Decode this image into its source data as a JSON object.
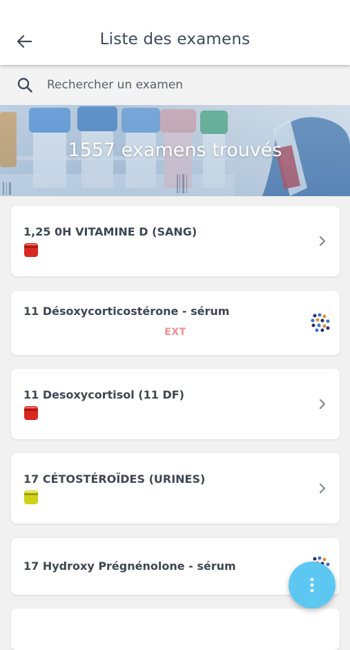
{
  "header": {
    "title": "Liste des examens",
    "back_icon": "arrow-left-icon"
  },
  "search": {
    "placeholder": "Rechercher un examen",
    "icon": "search-icon"
  },
  "banner": {
    "count_text": "1557 examens trouvés"
  },
  "exams": [
    {
      "name": "1,25 0H VITAMINE D (SANG)",
      "tube_color": "#d9281f",
      "action": "chevron"
    },
    {
      "name": "11 Désoxycorticostérone - sérum",
      "badge": "EXT",
      "action": "partner"
    },
    {
      "name": "11 Desoxycortisol (11 DF)",
      "tube_color": "#d9281f",
      "action": "chevron"
    },
    {
      "name": "17 CÉTOSTÉROÏDES (URINES)",
      "tube_color": "#cfd11a",
      "action": "chevron"
    },
    {
      "name": "17 Hydroxy Prégnénolone - sérum",
      "action": "partner"
    }
  ],
  "fab": {
    "icon": "more-vertical-icon"
  },
  "colors": {
    "accent": "#5cc8f2",
    "ext_badge": "#f08f8f",
    "title": "#3e4a57"
  }
}
